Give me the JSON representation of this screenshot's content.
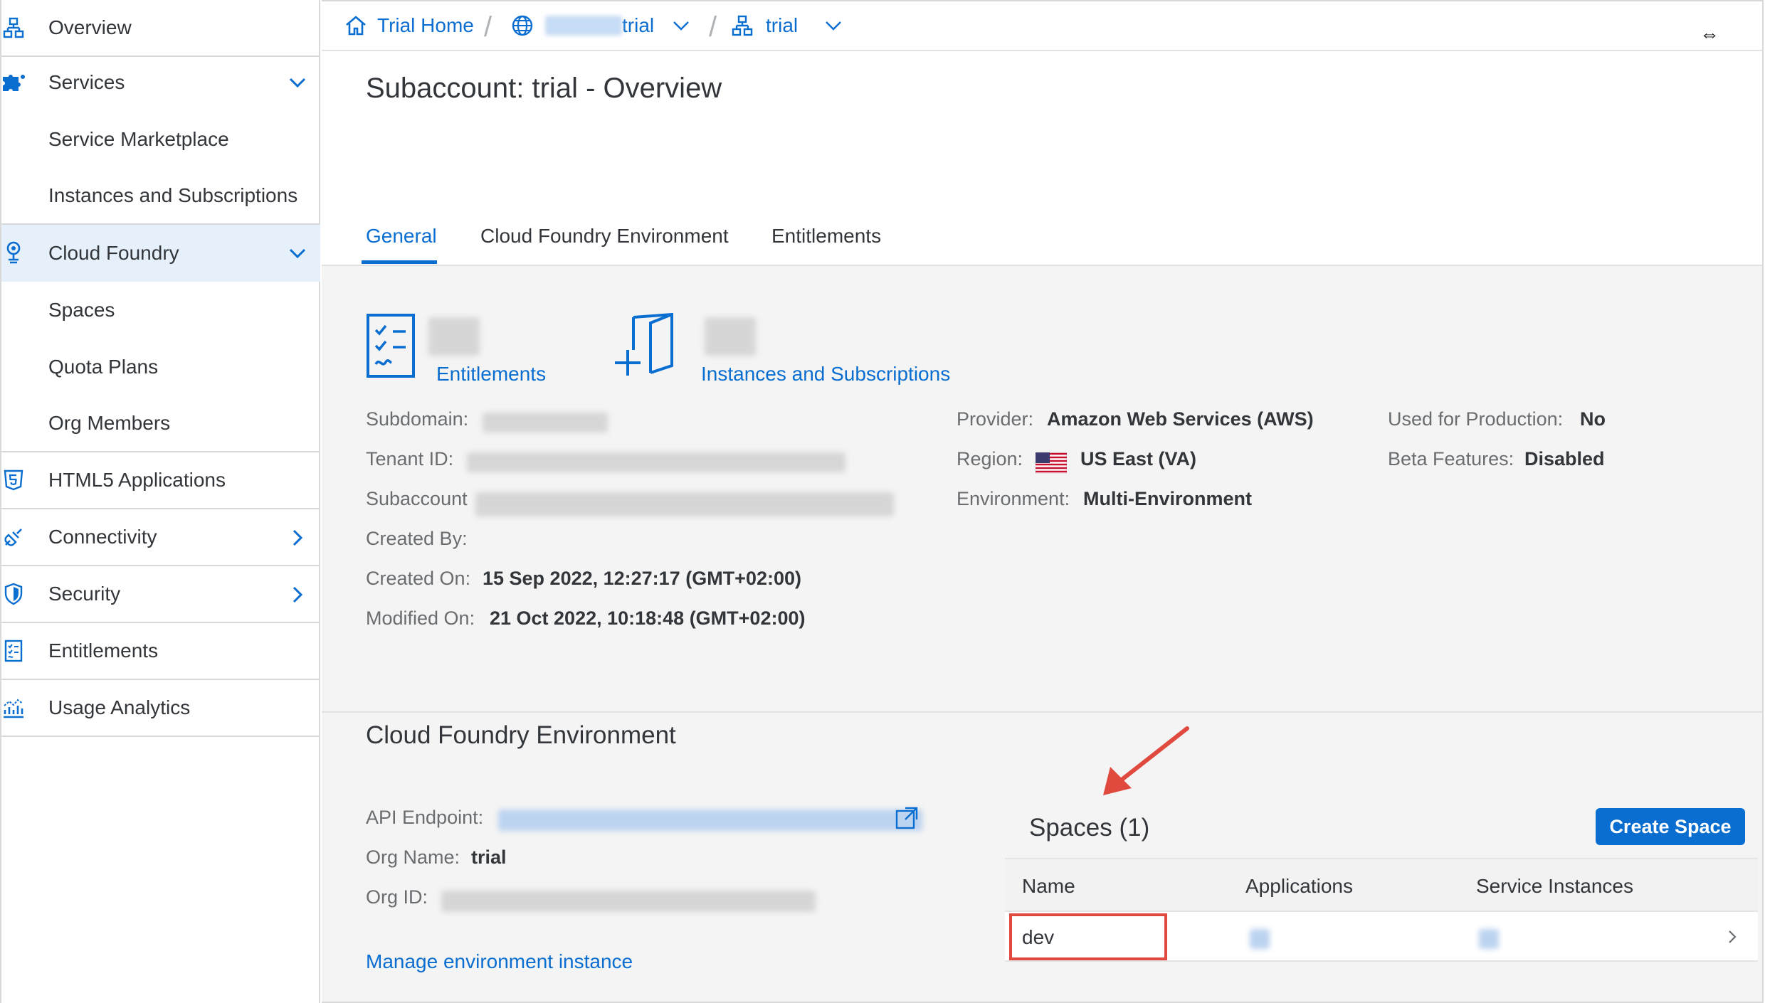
{
  "sidebar": {
    "items": [
      {
        "label": "Overview",
        "icon": "hierarchy-icon"
      },
      {
        "label": "Services",
        "icon": "puzzle-icon",
        "expanded": true
      },
      {
        "label": "Service Marketplace"
      },
      {
        "label": "Instances and Subscriptions"
      },
      {
        "label": "Cloud Foundry",
        "icon": "cloud-foundry-icon",
        "expanded": true,
        "selected": true
      },
      {
        "label": "Spaces"
      },
      {
        "label": "Quota Plans"
      },
      {
        "label": "Org Members"
      },
      {
        "label": "HTML5 Applications",
        "icon": "html5-icon"
      },
      {
        "label": "Connectivity",
        "icon": "connectivity-icon"
      },
      {
        "label": "Security",
        "icon": "shield-icon"
      },
      {
        "label": "Entitlements",
        "icon": "checklist-icon"
      },
      {
        "label": "Usage Analytics",
        "icon": "chart-icon"
      }
    ]
  },
  "breadcrumb": {
    "home": "Trial Home",
    "global_account_suffix": "trial",
    "subaccount": "trial"
  },
  "page": {
    "title": "Subaccount: trial - Overview",
    "tabs": [
      "General",
      "Cloud Foundry Environment",
      "Entitlements"
    ],
    "active_tab": "General"
  },
  "tiles": {
    "entitlements_link": "Entitlements",
    "instances_link": "Instances and Subscriptions"
  },
  "details": {
    "subdomain_label": "Subdomain:",
    "tenant_id_label": "Tenant ID:",
    "subaccount_label": "Subaccount",
    "created_by_label": "Created By:",
    "created_on_label": "Created On:",
    "created_on_value": "15 Sep 2022, 12:27:17 (GMT+02:00)",
    "modified_on_label": "Modified On:",
    "modified_on_value": "21 Oct 2022, 10:18:48 (GMT+02:00)",
    "provider_label": "Provider:",
    "provider_value": "Amazon Web Services (AWS)",
    "region_label": "Region:",
    "region_value": "US East (VA)",
    "environment_label": "Environment:",
    "environment_value": "Multi-Environment",
    "production_label": "Used for Production:",
    "production_value": "No",
    "beta_label": "Beta Features:",
    "beta_value": "Disabled"
  },
  "cf_env": {
    "title": "Cloud Foundry Environment",
    "api_label": "API Endpoint:",
    "org_name_label": "Org Name:",
    "org_name_value": "trial",
    "org_id_label": "Org ID:",
    "manage_link": "Manage environment instance"
  },
  "spaces": {
    "title": "Spaces (1)",
    "create_button": "Create Space",
    "columns": [
      "Name",
      "Applications",
      "Service Instances"
    ],
    "rows": [
      {
        "name": "dev"
      }
    ]
  },
  "colors": {
    "accent": "#0a6ed1",
    "highlight": "#e0493e",
    "selected_bg": "#e5f0fa"
  }
}
